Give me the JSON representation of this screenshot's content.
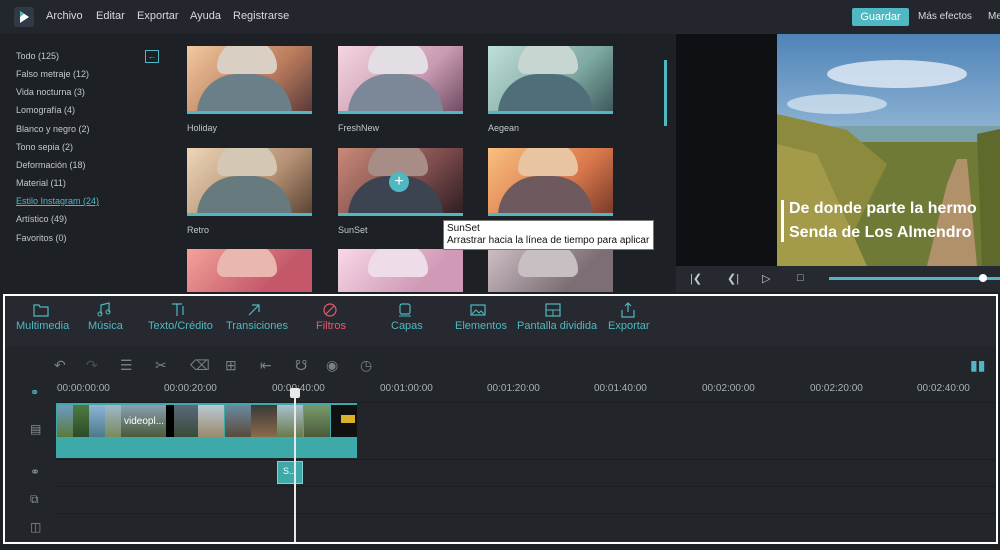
{
  "menu": [
    "Archivo",
    "Editar",
    "Exportar",
    "Ayuda",
    "Registrarse"
  ],
  "actions": {
    "save": "Guardar",
    "more_effects": "Más efectos",
    "cut_text": "Me"
  },
  "categories": [
    {
      "label": "Todo (125)"
    },
    {
      "label": "Falso metraje (12)"
    },
    {
      "label": "Vida nocturna (3)"
    },
    {
      "label": "Lomografía (4)"
    },
    {
      "label": "Blanco y negro (2)"
    },
    {
      "label": "Tono sepia (2)"
    },
    {
      "label": "Deformación (18)"
    },
    {
      "label": "Material (11)"
    },
    {
      "label": "Estilo Instagram (24)"
    },
    {
      "label": "Artístico (49)"
    },
    {
      "label": "Favoritos (0)"
    }
  ],
  "filters": [
    {
      "name": "Holiday"
    },
    {
      "name": "FreshNew"
    },
    {
      "name": "Aegean"
    },
    {
      "name": "Retro"
    },
    {
      "name": "SunSet"
    },
    {
      "name": ""
    },
    {
      "name": ""
    },
    {
      "name": ""
    },
    {
      "name": ""
    }
  ],
  "tooltip": {
    "title": "SunSet",
    "text": "Arrastrar hacia la línea de tiempo para aplicar"
  },
  "preview": {
    "line1": "De donde parte la hermo",
    "line2": "Senda de Los Almendro"
  },
  "tools": [
    "Multimedia",
    "Música",
    "Texto/Crédito",
    "Transiciones",
    "Filtros",
    "Capas",
    "Elementos",
    "Pantalla dividida",
    "Exportar"
  ],
  "timeline": {
    "ticks": [
      "00:00:00:00",
      "00:00:20:00",
      "00:00:40:00",
      "00:01:00:00",
      "00:01:20:00",
      "00:01:40:00",
      "00:02:00:00",
      "00:02:20:00",
      "00:02:40:00"
    ],
    "clip_name": "videopl...",
    "effect_label": "S..."
  },
  "colors": {
    "accent": "#4fb8c2",
    "active_tool": "#f0586a"
  }
}
